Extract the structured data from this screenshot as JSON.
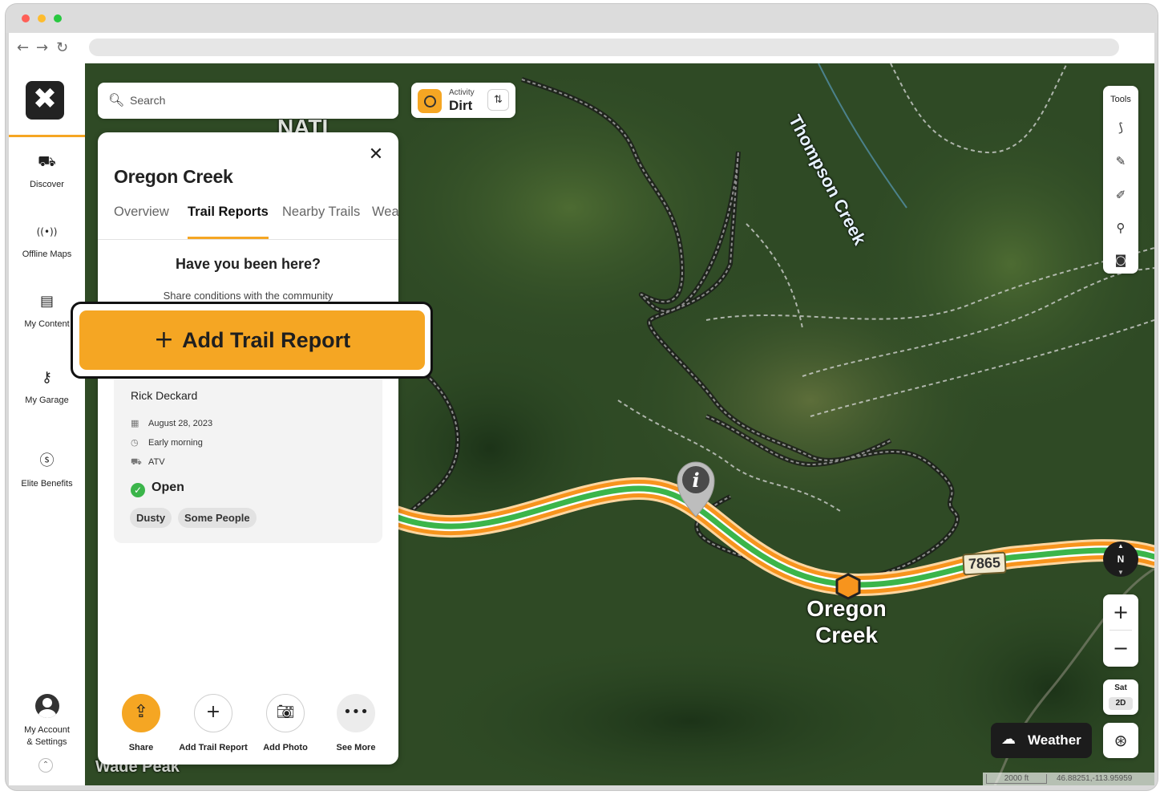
{
  "rail": {
    "items": [
      {
        "label": "Discover",
        "icon": "discover-icon"
      },
      {
        "label": "Offline Maps",
        "icon": "offline-maps-icon"
      },
      {
        "label": "My Content",
        "icon": "my-content-icon"
      },
      {
        "label": "My Garage",
        "icon": "my-garage-icon"
      },
      {
        "label": "Elite Benefits",
        "icon": "elite-benefits-icon"
      }
    ],
    "account": {
      "line1": "My Account",
      "line2": "& Settings"
    }
  },
  "search": {
    "placeholder": "Search"
  },
  "activity": {
    "label": "Activity",
    "value": "Dirt"
  },
  "panel": {
    "title": "Oregon Creek",
    "tabs": [
      {
        "label": "Overview",
        "active": false
      },
      {
        "label": "Trail Reports",
        "active": true
      },
      {
        "label": "Nearby Trails",
        "active": false
      },
      {
        "label": "Weather",
        "active": false
      }
    ],
    "question": "Have you been here?",
    "subtitle": "Share conditions with the community",
    "primary_button": "Add Trail Report",
    "report": {
      "author": "Rick Deckard",
      "date": "August 28, 2023",
      "time_of_day": "Early morning",
      "vehicle": "ATV",
      "status": "Open",
      "status_color": "#3bb54a",
      "tags": [
        "Dusty",
        "Some People"
      ]
    },
    "actions": [
      {
        "label": "Share",
        "icon": "share-icon"
      },
      {
        "label": "Add Trail Report",
        "icon": "plus-icon"
      },
      {
        "label": "Add Photo",
        "icon": "camera-icon"
      },
      {
        "label": "See More",
        "icon": "more-icon"
      }
    ]
  },
  "tools": {
    "label": "Tools"
  },
  "compass": {
    "label": "N"
  },
  "layers": {
    "type": "Sat",
    "mode": "2D"
  },
  "weather": {
    "label": "Weather"
  },
  "scale": {
    "distance": "2000 ft",
    "coords": "46.88251,-113.95959"
  },
  "map": {
    "labels": {
      "creek_top": "Thompson Creek",
      "place": "Oregon Creek",
      "road_number": "7865",
      "peak": "Wade Peak",
      "area": "NATI"
    },
    "accent": "#f5a623",
    "trail_green": "#3bb54a"
  }
}
